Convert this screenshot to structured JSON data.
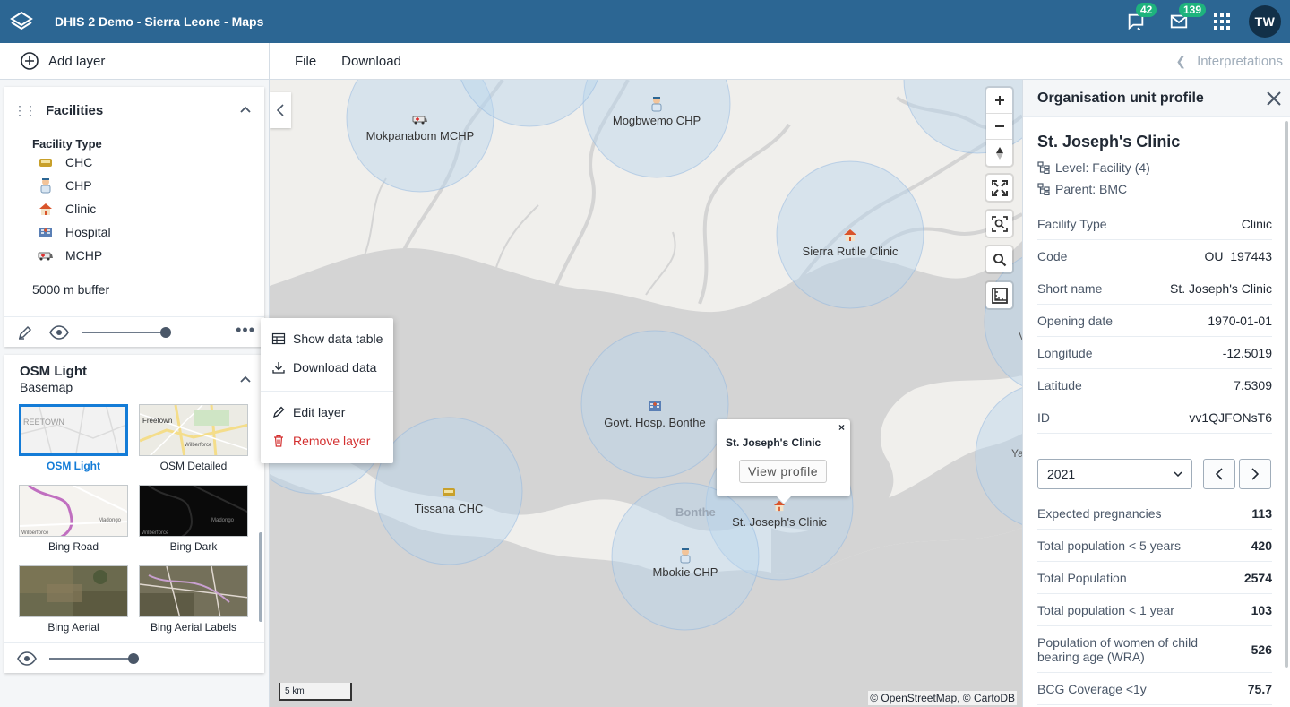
{
  "header": {
    "title": "DHIS 2 Demo - Sierra Leone - Maps",
    "interpretations_count": "42",
    "messages_count": "139",
    "user_initials": "TW",
    "brand_color": "#2c6693"
  },
  "toolbar": {
    "add_layer": "Add layer",
    "file": "File",
    "download": "Download",
    "interpretations": "Interpretations"
  },
  "facilities_layer": {
    "title": "Facilities",
    "legend_title": "Facility Type",
    "legend": [
      {
        "label": "CHC",
        "icon": "chc-icon"
      },
      {
        "label": "CHP",
        "icon": "chp-icon"
      },
      {
        "label": "Clinic",
        "icon": "clinic-icon"
      },
      {
        "label": "Hospital",
        "icon": "hospital-icon"
      },
      {
        "label": "MCHP",
        "icon": "mchp-icon"
      }
    ],
    "buffer": "5000 m buffer",
    "opacity": 1.0
  },
  "context_menu": {
    "show_data_table": "Show data table",
    "download_data": "Download data",
    "edit_layer": "Edit layer",
    "remove_layer": "Remove layer"
  },
  "basemap_layer": {
    "title": "OSM Light",
    "subtitle": "Basemap",
    "selected": "OSM Light",
    "options": [
      "OSM Light",
      "OSM Detailed",
      "Bing Road",
      "Bing Dark",
      "Bing Aerial",
      "Bing Aerial Labels"
    ],
    "thumb_text": {
      "osm_light": "REETOWN",
      "osm_detailed": "Freetown",
      "osm_detailed_small": "Wilberforce",
      "bing_road": "Wilberforce",
      "bing_road_2": "Madongo",
      "bing_dark": "Madongo",
      "bing_dark_2": "Wilberforce"
    },
    "opacity": 1.0
  },
  "map": {
    "facilities": [
      {
        "name": "Mokpanabom MCHP",
        "type": "MCHP"
      },
      {
        "name": "Mogbwemo CHP",
        "type": "CHP"
      },
      {
        "name": "Sierra Rutile Clinic",
        "type": "Clinic"
      },
      {
        "name": "Govt. Hosp. Bonthe",
        "type": "Hospital"
      },
      {
        "name": "Tissana CHC",
        "type": "CHC"
      },
      {
        "name": "St. Joseph's Clinic",
        "type": "Clinic"
      },
      {
        "name": "Mbokie CHP",
        "type": "CHP"
      }
    ],
    "town_label": "Bonthe",
    "edge_labels": [
      "V",
      "Ya"
    ],
    "popup": {
      "title": "St. Joseph's Clinic",
      "close": "×",
      "button": "View profile"
    },
    "scale": "5 km",
    "attribution": "© OpenStreetMap, © CartoDB"
  },
  "profile": {
    "panel_title": "Organisation unit profile",
    "name": "St. Joseph's Clinic",
    "level": "Level: Facility (4)",
    "parent": "Parent: BMC",
    "attributes": [
      {
        "key": "Facility Type",
        "value": "Clinic"
      },
      {
        "key": "Code",
        "value": "OU_197443"
      },
      {
        "key": "Short name",
        "value": "St. Joseph's Clinic"
      },
      {
        "key": "Opening date",
        "value": "1970-01-01"
      },
      {
        "key": "Longitude",
        "value": "-12.5019"
      },
      {
        "key": "Latitude",
        "value": "7.5309"
      },
      {
        "key": "ID",
        "value": "vv1QJFONsT6"
      }
    ],
    "period": "2021",
    "data": [
      {
        "key": "Expected pregnancies",
        "value": "113"
      },
      {
        "key": "Total population < 5 years",
        "value": "420"
      },
      {
        "key": "Total Population",
        "value": "2574"
      },
      {
        "key": "Total population < 1 year",
        "value": "103"
      },
      {
        "key": "Population of women of child bearing age (WRA)",
        "value": "526"
      },
      {
        "key": "BCG Coverage <1y",
        "value": "75.7"
      }
    ]
  }
}
